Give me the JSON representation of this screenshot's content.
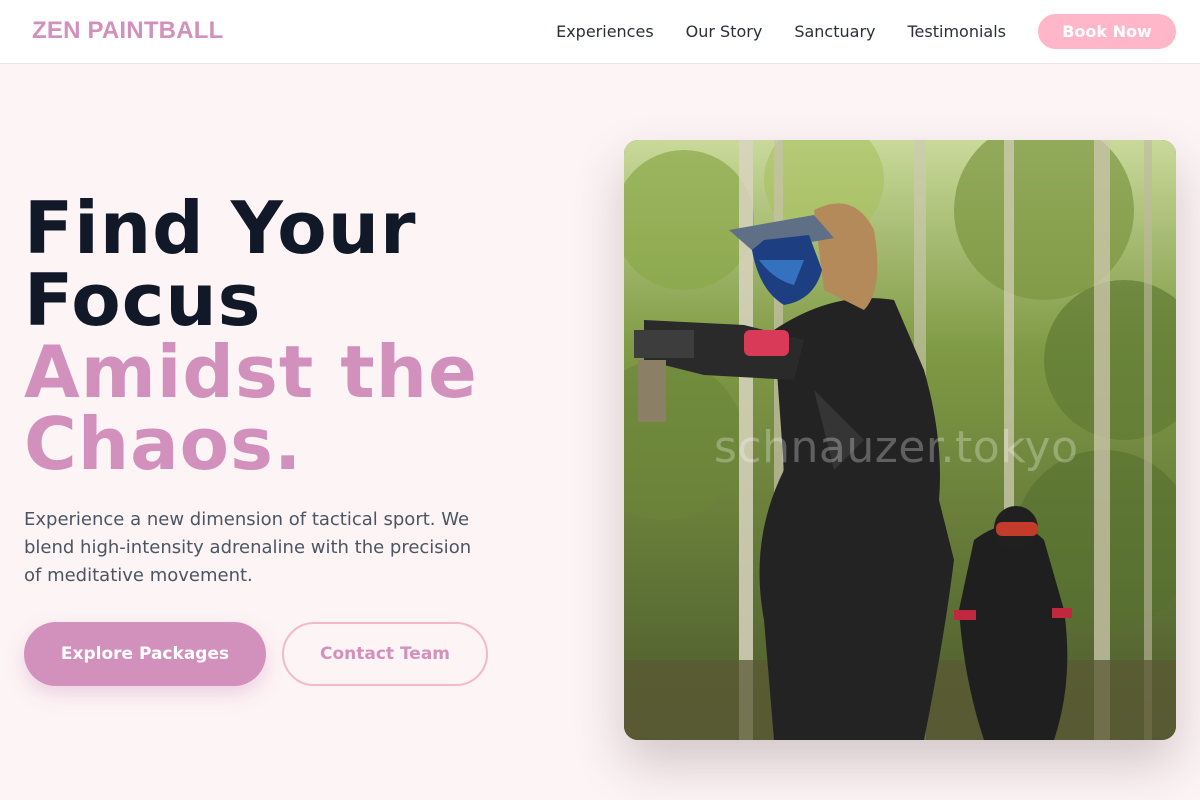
{
  "brand": {
    "name": "ZEN PAINTBALL",
    "accent_color": "#d291bc",
    "button_pink": "#ffb6c8"
  },
  "nav": {
    "links": [
      "Experiences",
      "Our Story",
      "Sanctuary",
      "Testimonials"
    ],
    "cta_label": "Book Now"
  },
  "hero": {
    "title_line1": "Find Your",
    "title_line2": "Focus",
    "accent_line1": "Amidst the",
    "accent_line2": "Chaos.",
    "description": "Experience a new dimension of tactical sport. We blend high-intensity adrenaline with the precision of meditative movement.",
    "primary_cta": "Explore Packages",
    "secondary_cta": "Contact Team"
  },
  "photo": {
    "subject": "paintball players in camouflage gear aiming in a birch forest",
    "watermark": "schnauzer.tokyo"
  }
}
